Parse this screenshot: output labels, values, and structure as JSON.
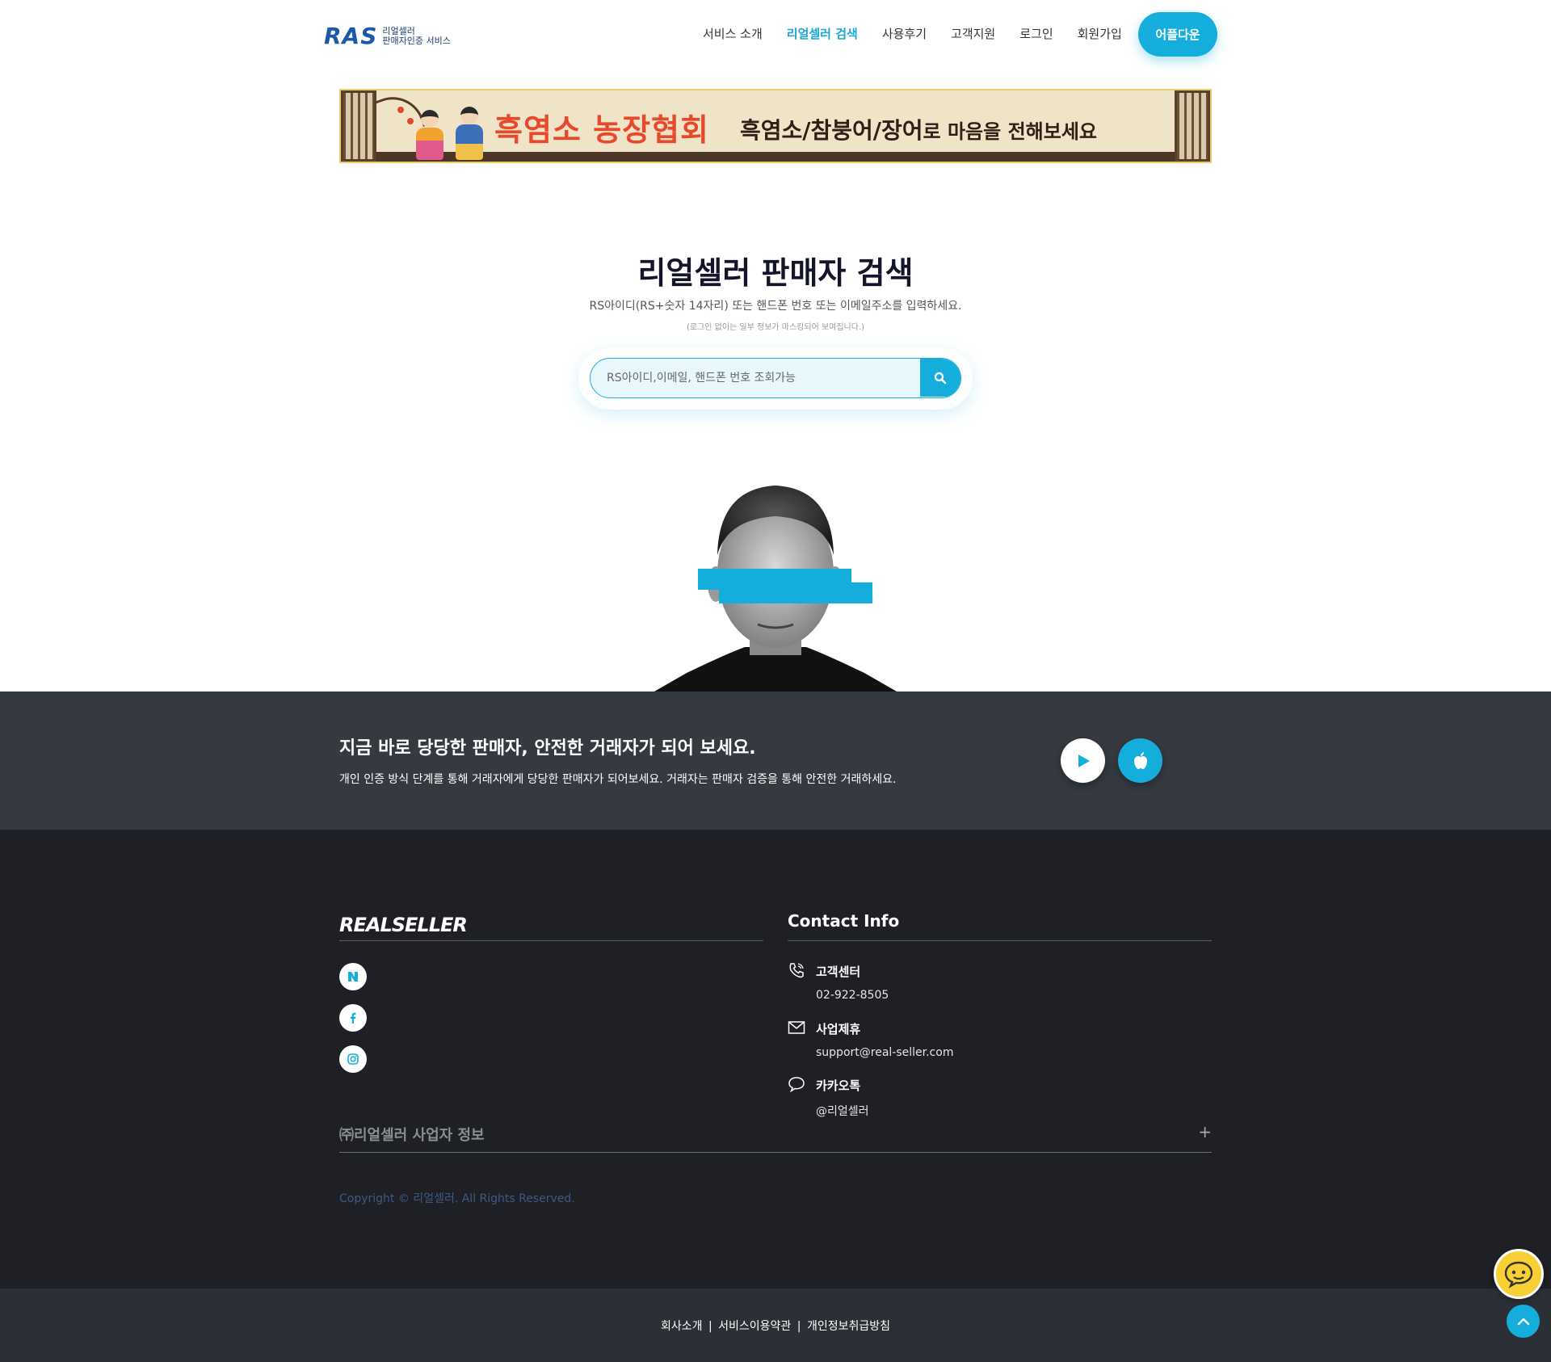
{
  "brand": {
    "logo_mark": "RAS",
    "logo_line1": "리얼셀러",
    "logo_line2": "판매자인증 서비스",
    "accent_color": "#15aedc"
  },
  "nav": {
    "items": [
      {
        "label": "서비스 소개",
        "active": false
      },
      {
        "label": "리얼셀러 검색",
        "active": true
      },
      {
        "label": "사용후기",
        "active": false
      },
      {
        "label": "고객지원",
        "active": false
      },
      {
        "label": "로그인",
        "active": false
      },
      {
        "label": "회원가입",
        "active": false
      }
    ],
    "app_button": "어플다운"
  },
  "banner": {
    "title": "흑염소 농장협회",
    "subtitle_bold": "흑염소/참붕어/장어",
    "subtitle_rest": "로 마음을 전해보세요"
  },
  "search": {
    "title": "리얼셀러 판매자 검색",
    "description": "RS아이디(RS+숫자 14자리) 또는 핸드폰 번호 또는 이메일주소를 입력하세요.",
    "note": "(로그인 없이는 일부 정보가 마스킹되어 보여집니다.)",
    "placeholder": "RS아이디,이메일, 핸드폰 번호 조회가능",
    "value": ""
  },
  "cta": {
    "title": "지금 바로 당당한 판매자, 안전한 거래자가 되어 보세요.",
    "description": "개인 인증 방식 단계를 통해 거래자에게 당당한 판매자가 되어보세요. 거래자는 판매자 검증을 통해 안전한 거래하세요.",
    "store_icons": [
      "google-play-icon",
      "apple-icon"
    ]
  },
  "footer": {
    "logo": "REALSELLER",
    "social_icons": [
      "naver-icon",
      "facebook-icon",
      "instagram-icon"
    ],
    "contact_title": "Contact Info",
    "contacts": [
      {
        "icon": "phone-icon",
        "label": "고객센터",
        "value": "02-922-8505"
      },
      {
        "icon": "mail-icon",
        "label": "사업제휴",
        "value": "support@real-seller.com"
      },
      {
        "icon": "chat-bubble-icon",
        "label": "카카오톡",
        "value": "@리얼셀러"
      }
    ],
    "business_info": "㈜리얼셀러 사업자 정보",
    "business_toggle": "+",
    "copyright": "Copyright © 리얼셀러. All Rights Reserved.",
    "bottom_links": [
      "회사소개",
      "서비스이용약관",
      "개인정보취급방침"
    ],
    "separator": "|"
  }
}
